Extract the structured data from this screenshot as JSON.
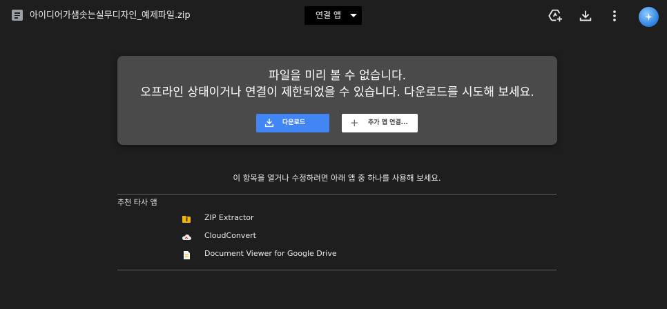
{
  "header": {
    "file_name": "아이디어가샘솟는실무디자인_예제파일.zip",
    "file_icon": "file-document-icon",
    "open_with_label": "연결 앱",
    "icons": [
      "add-to-drive-icon",
      "download-icon",
      "more-vert-icon",
      "account-avatar"
    ]
  },
  "card": {
    "line1": "파일을 미리 볼 수 없습니다.",
    "line2": "오프라인 상태이거나 연결이 제한되었을 수 있습니다. 다운로드를 시도해 보세요.",
    "download_label": "다운로드",
    "connect_label": "추가 앱 연결..."
  },
  "suggestions": {
    "hint": "이 항목을 열거나 수정하려면 아래 앱 중 하나를 사용해 보세요.",
    "section_label": "추천 타사 앱",
    "apps": [
      {
        "name": "ZIP Extractor",
        "icon": "zip-extractor-icon"
      },
      {
        "name": "CloudConvert",
        "icon": "cloudconvert-icon"
      },
      {
        "name": "Document Viewer for Google Drive",
        "icon": "document-viewer-icon"
      }
    ]
  },
  "colors": {
    "background": "#1e1e1e",
    "card": "#4a4a4a",
    "primary_button": "#4285f4"
  }
}
